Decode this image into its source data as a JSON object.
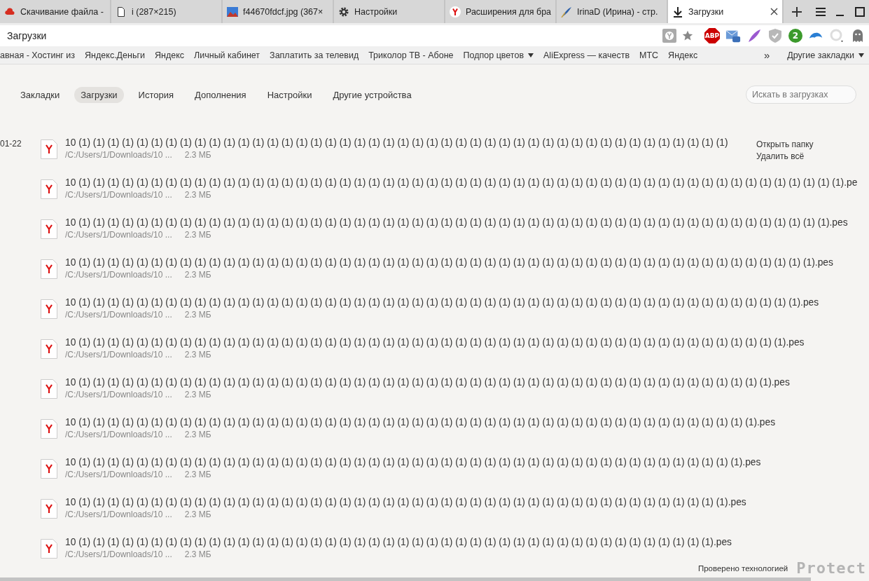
{
  "tabs": [
    {
      "kind": "cloud",
      "title": "Скачивание файла -",
      "selected": false
    },
    {
      "kind": "page",
      "title": "i (287×215)",
      "selected": false
    },
    {
      "kind": "image",
      "title": "f44670fdcf.jpg (367×",
      "selected": false
    },
    {
      "kind": "gear",
      "title": "Настройки",
      "selected": false
    },
    {
      "kind": "yandex",
      "title": "Расширения для бра",
      "selected": false
    },
    {
      "kind": "quill",
      "title": "IrinaD (Ирина) - стр.",
      "selected": false
    },
    {
      "kind": "download",
      "title": "Загрузки",
      "selected": true
    }
  ],
  "address": {
    "value": "Загрузки"
  },
  "extensions": [
    {
      "kind": "abp",
      "text": "ABP"
    },
    {
      "kind": "mail"
    },
    {
      "kind": "feather"
    },
    {
      "kind": "shield"
    },
    {
      "kind": "badge",
      "text": "2"
    },
    {
      "kind": "cloud"
    },
    {
      "kind": "ring"
    },
    {
      "kind": "ghost"
    }
  ],
  "bookmarks": [
    {
      "label": "авная - Хостинг из",
      "folder": false
    },
    {
      "label": "Яндекс.Деньги",
      "folder": false
    },
    {
      "label": "Яндекс",
      "folder": false
    },
    {
      "label": "Личный кабинет",
      "folder": false
    },
    {
      "label": "Заплатить за телевид",
      "folder": false
    },
    {
      "label": "Триколор ТВ - Абоне",
      "folder": false
    },
    {
      "label": "Подпор цветов",
      "folder": true
    },
    {
      "label": "AliExpress — качеств",
      "folder": false
    },
    {
      "label": "МТС",
      "folder": false
    },
    {
      "label": "Яндекс",
      "folder": false
    }
  ],
  "other_bookmarks": {
    "chevron": "»",
    "label": "Другие закладки"
  },
  "nav": [
    {
      "label": "Закладки",
      "selected": false
    },
    {
      "label": "Загрузки",
      "selected": true
    },
    {
      "label": "История",
      "selected": false
    },
    {
      "label": "Дополнения",
      "selected": false
    },
    {
      "label": "Настройки",
      "selected": false
    },
    {
      "label": "Другие устройства",
      "selected": false
    }
  ],
  "search": {
    "placeholder": "Искать в загрузках"
  },
  "date": "01-22",
  "actions": [
    "Открыть папку",
    "Удалить всё"
  ],
  "downloads": [
    {
      "name": "10 (1) (1) (1) (1) (1) (1) (1) (1) (1) (1) (1) (1) (1) (1) (1) (1) (1) (1) (1) (1) (1) (1) (1) (1) (1) (1) (1) (1) (1) (1) (1) (1) (1) (1) (1) (1) (1) (1) (1) (1) (1) (1) (1) (1) (1)",
      "path": "/C:/Users/1/Downloads/10 ...",
      "size": "2.3 МБ"
    },
    {
      "name": "10 (1) (1) (1) (1) (1) (1) (1) (1) (1) (1) (1) (1) (1) (1) (1) (1) (1) (1) (1) (1) (1) (1) (1) (1) (1) (1) (1) (1) (1) (1) (1) (1) (1) (1) (1) (1) (1) (1) (1) (1) (1) (1) (1) (1) (1) (1) (1) (1) (1) (1) (1) (1) (1).pe",
      "path": "/C:/Users/1/Downloads/10 ...",
      "size": "2.3 МБ"
    },
    {
      "name": "10 (1) (1) (1) (1) (1) (1) (1) (1) (1) (1) (1) (1) (1) (1) (1) (1) (1) (1) (1) (1) (1) (1) (1) (1) (1) (1) (1) (1) (1) (1) (1) (1) (1) (1) (1) (1) (1) (1) (1) (1) (1) (1) (1) (1) (1) (1) (1) (1) (1) (1) (1) (1).pes",
      "path": "/C:/Users/1/Downloads/10 ...",
      "size": "2.3 МБ"
    },
    {
      "name": "10 (1) (1) (1) (1) (1) (1) (1) (1) (1) (1) (1) (1) (1) (1) (1) (1) (1) (1) (1) (1) (1) (1) (1) (1) (1) (1) (1) (1) (1) (1) (1) (1) (1) (1) (1) (1) (1) (1) (1) (1) (1) (1) (1) (1) (1) (1) (1) (1) (1) (1) (1).pes",
      "path": "/C:/Users/1/Downloads/10 ...",
      "size": "2.3 МБ"
    },
    {
      "name": "10 (1) (1) (1) (1) (1) (1) (1) (1) (1) (1) (1) (1) (1) (1) (1) (1) (1) (1) (1) (1) (1) (1) (1) (1) (1) (1) (1) (1) (1) (1) (1) (1) (1) (1) (1) (1) (1) (1) (1) (1) (1) (1) (1) (1) (1) (1) (1) (1) (1) (1).pes",
      "path": "/C:/Users/1/Downloads/10 ...",
      "size": "2.3 МБ"
    },
    {
      "name": "10 (1) (1) (1) (1) (1) (1) (1) (1) (1) (1) (1) (1) (1) (1) (1) (1) (1) (1) (1) (1) (1) (1) (1) (1) (1) (1) (1) (1) (1) (1) (1) (1) (1) (1) (1) (1) (1) (1) (1) (1) (1) (1) (1) (1) (1) (1) (1) (1) (1).pes",
      "path": "/C:/Users/1/Downloads/10 ...",
      "size": "2.3 МБ"
    },
    {
      "name": "10 (1) (1) (1) (1) (1) (1) (1) (1) (1) (1) (1) (1) (1) (1) (1) (1) (1) (1) (1) (1) (1) (1) (1) (1) (1) (1) (1) (1) (1) (1) (1) (1) (1) (1) (1) (1) (1) (1) (1) (1) (1) (1) (1) (1) (1) (1) (1) (1).pes",
      "path": "/C:/Users/1/Downloads/10 ...",
      "size": "2.3 МБ"
    },
    {
      "name": "10 (1) (1) (1) (1) (1) (1) (1) (1) (1) (1) (1) (1) (1) (1) (1) (1) (1) (1) (1) (1) (1) (1) (1) (1) (1) (1) (1) (1) (1) (1) (1) (1) (1) (1) (1) (1) (1) (1) (1) (1) (1) (1) (1) (1) (1) (1) (1).pes",
      "path": "/C:/Users/1/Downloads/10 ...",
      "size": "2.3 МБ"
    },
    {
      "name": "10 (1) (1) (1) (1) (1) (1) (1) (1) (1) (1) (1) (1) (1) (1) (1) (1) (1) (1) (1) (1) (1) (1) (1) (1) (1) (1) (1) (1) (1) (1) (1) (1) (1) (1) (1) (1) (1) (1) (1) (1) (1) (1) (1) (1) (1) (1).pes",
      "path": "/C:/Users/1/Downloads/10 ...",
      "size": "2.3 МБ"
    },
    {
      "name": "10 (1) (1) (1) (1) (1) (1) (1) (1) (1) (1) (1) (1) (1) (1) (1) (1) (1) (1) (1) (1) (1) (1) (1) (1) (1) (1) (1) (1) (1) (1) (1) (1) (1) (1) (1) (1) (1) (1) (1) (1) (1) (1) (1) (1) (1).pes",
      "path": "/C:/Users/1/Downloads/10 ...",
      "size": "2.3 МБ"
    },
    {
      "name": "10 (1) (1) (1) (1) (1) (1) (1) (1) (1) (1) (1) (1) (1) (1) (1) (1) (1) (1) (1) (1) (1) (1) (1) (1) (1) (1) (1) (1) (1) (1) (1) (1) (1) (1) (1) (1) (1) (1) (1) (1) (1) (1) (1) (1).pes",
      "path": "/C:/Users/1/Downloads/10 ...",
      "size": "2.3 МБ"
    }
  ],
  "footer": {
    "caption": "Проверено технологией",
    "logo": "Protect"
  }
}
